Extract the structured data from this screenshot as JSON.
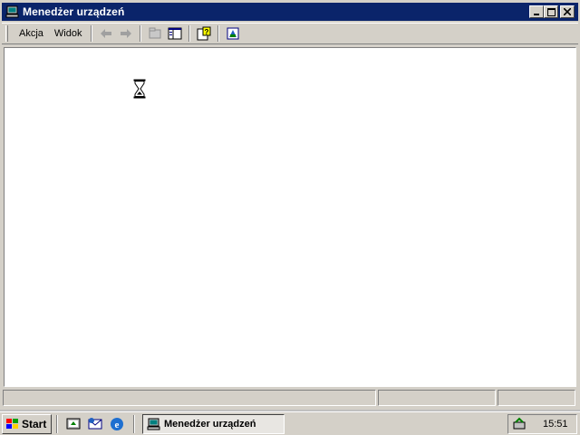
{
  "window": {
    "title": "Menedżer urządzeń"
  },
  "menu": {
    "items": [
      {
        "label": "Akcja",
        "mnemonic": "A"
      },
      {
        "label": "Widok",
        "mnemonic": "W"
      }
    ]
  },
  "toolbar": {
    "icons": [
      "back-arrow-icon",
      "forward-arrow-icon",
      "properties-icon",
      "show-hide-tree-icon",
      "help-icon",
      "device-icon"
    ]
  },
  "taskbar": {
    "start_label": "Start",
    "task_title": "Menedżer urządzeń",
    "clock": "15:51"
  },
  "colors": {
    "titlebar": "#0a246a",
    "face": "#d4d0c8",
    "content": "#ffffff"
  }
}
